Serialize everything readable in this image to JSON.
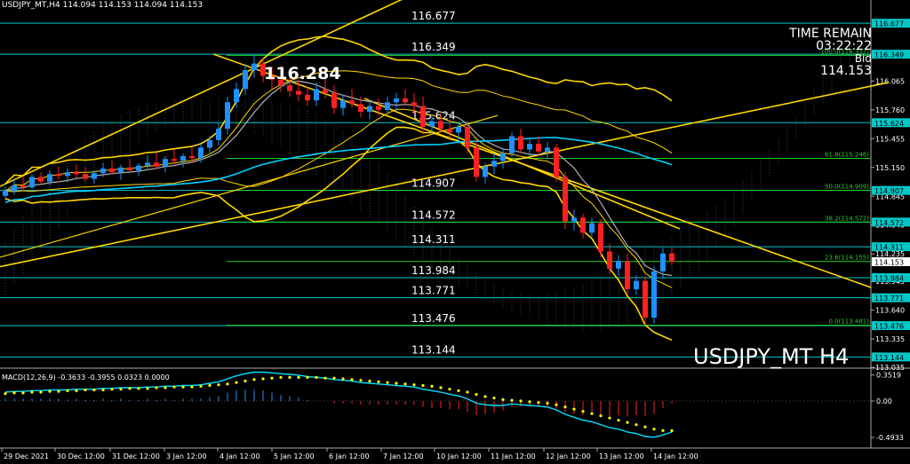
{
  "header": {
    "symbol": "USDJPY_MT,H4",
    "ohlc": "114.094 114.153 114.094 114.153"
  },
  "info": {
    "time_remain_label": "TIME REMAIN",
    "time_remain": "03:22:22",
    "bid_label": "Bid",
    "bid": "114.153"
  },
  "watermark": "USDJPY_MT H4",
  "peak_label": "116.284",
  "colors": {
    "bull": "#1e90ff",
    "bear": "#ff2020",
    "level": "#00c8c8",
    "fib": "#20d020",
    "trend": "#ffd700",
    "ma_fast": "#b0b0b0",
    "ma_slow": "#00d0ff",
    "cloud": "#707070",
    "macd_signal": "#ffff00",
    "macd_line": "#00e0ff",
    "price_tag": "#ffffff"
  },
  "chart_data": {
    "type": "candlestick",
    "ylim": [
      113.035,
      116.81
    ],
    "price_axis_ticks": [
      "116.065",
      "115.760",
      "115.455",
      "115.150",
      "114.845",
      "114.540",
      "114.235",
      "113.945",
      "113.640",
      "113.335",
      "113.035"
    ],
    "time_axis_labels": [
      "29 Dec 2021",
      "30 Dec 12:00",
      "31 Dec 12:00",
      "3 Jan 12:00",
      "4 Jan 12:00",
      "5 Jan 12:00",
      "6 Jan 12:00",
      "7 Jan 12:00",
      "10 Jan 12:00",
      "11 Jan 12:00",
      "12 Jan 12:00",
      "13 Jan 12:00",
      "14 Jan 12:00"
    ],
    "levels": [
      {
        "label": "116.677",
        "value": 116.677
      },
      {
        "label": "116.349",
        "value": 116.349
      },
      {
        "label": "115.624",
        "value": 115.624
      },
      {
        "label": "114.907",
        "value": 114.907
      },
      {
        "label": "114.572",
        "value": 114.572
      },
      {
        "label": "114.311",
        "value": 114.311
      },
      {
        "label": "113.984",
        "value": 113.984
      },
      {
        "label": "113.771",
        "value": 113.771
      },
      {
        "label": "113.476",
        "value": 113.476
      },
      {
        "label": "113.144",
        "value": 113.144
      }
    ],
    "fibonacci": [
      {
        "label": "100.0(116.337)",
        "value": 116.337
      },
      {
        "label": "61.8(115.246)",
        "value": 115.246
      },
      {
        "label": "50.0(114.909)",
        "value": 114.909
      },
      {
        "label": "38.2(114.572)",
        "value": 114.572
      },
      {
        "label": "23.6(114.155)",
        "value": 114.155
      },
      {
        "label": "0.0(113.481)",
        "value": 113.481
      }
    ],
    "current_price": {
      "label": "114.153",
      "value": 114.153
    },
    "candles": [
      [
        114.85,
        114.95,
        114.8,
        114.9
      ],
      [
        114.9,
        115.02,
        114.86,
        114.96
      ],
      [
        114.96,
        115.05,
        114.9,
        114.94
      ],
      [
        114.94,
        115.08,
        114.92,
        115.05
      ],
      [
        115.05,
        115.1,
        114.98,
        115.0
      ],
      [
        115.0,
        115.12,
        114.96,
        115.08
      ],
      [
        115.08,
        115.16,
        115.02,
        115.06
      ],
      [
        115.06,
        115.14,
        115.0,
        115.1
      ],
      [
        115.1,
        115.18,
        115.04,
        115.08
      ],
      [
        115.08,
        115.15,
        115.0,
        115.03
      ],
      [
        115.03,
        115.12,
        114.98,
        115.09
      ],
      [
        115.09,
        115.2,
        115.05,
        115.14
      ],
      [
        115.14,
        115.22,
        115.08,
        115.1
      ],
      [
        115.1,
        115.18,
        115.02,
        115.15
      ],
      [
        115.15,
        115.24,
        115.1,
        115.12
      ],
      [
        115.12,
        115.2,
        115.06,
        115.17
      ],
      [
        115.17,
        115.28,
        115.12,
        115.2
      ],
      [
        115.2,
        115.3,
        115.14,
        115.16
      ],
      [
        115.16,
        115.27,
        115.1,
        115.24
      ],
      [
        115.24,
        115.34,
        115.18,
        115.22
      ],
      [
        115.22,
        115.3,
        115.15,
        115.27
      ],
      [
        115.27,
        115.36,
        115.2,
        115.25
      ],
      [
        115.25,
        115.4,
        115.2,
        115.36
      ],
      [
        115.36,
        115.48,
        115.3,
        115.44
      ],
      [
        115.44,
        115.62,
        115.38,
        115.56
      ],
      [
        115.56,
        115.9,
        115.5,
        115.84
      ],
      [
        115.84,
        116.05,
        115.78,
        115.98
      ],
      [
        115.98,
        116.25,
        115.92,
        116.18
      ],
      [
        116.18,
        116.34,
        116.1,
        116.25
      ],
      [
        116.25,
        116.3,
        116.05,
        116.12
      ],
      [
        116.12,
        116.22,
        115.98,
        116.08
      ],
      [
        116.08,
        116.18,
        115.95,
        116.02
      ],
      [
        116.02,
        116.12,
        115.9,
        115.96
      ],
      [
        115.96,
        116.08,
        115.85,
        115.92
      ],
      [
        115.92,
        116.0,
        115.8,
        115.86
      ],
      [
        115.86,
        116.05,
        115.8,
        115.98
      ],
      [
        115.98,
        116.1,
        115.88,
        115.94
      ],
      [
        115.94,
        116.02,
        115.72,
        115.78
      ],
      [
        115.78,
        115.92,
        115.7,
        115.86
      ],
      [
        115.86,
        115.98,
        115.78,
        115.82
      ],
      [
        115.82,
        115.9,
        115.68,
        115.74
      ],
      [
        115.74,
        115.86,
        115.66,
        115.8
      ],
      [
        115.8,
        115.88,
        115.7,
        115.76
      ],
      [
        115.76,
        115.9,
        115.72,
        115.84
      ],
      [
        115.84,
        115.94,
        115.76,
        115.88
      ],
      [
        115.88,
        115.98,
        115.8,
        115.84
      ],
      [
        115.84,
        115.94,
        115.72,
        115.8
      ],
      [
        115.8,
        115.9,
        115.5,
        115.58
      ],
      [
        115.58,
        115.7,
        115.5,
        115.64
      ],
      [
        115.64,
        115.72,
        115.52,
        115.56
      ],
      [
        115.56,
        115.66,
        115.44,
        115.52
      ],
      [
        115.52,
        115.62,
        115.4,
        115.58
      ],
      [
        115.58,
        115.64,
        115.3,
        115.36
      ],
      [
        115.36,
        115.44,
        115.0,
        115.05
      ],
      [
        115.05,
        115.2,
        114.98,
        115.16
      ],
      [
        115.16,
        115.3,
        115.08,
        115.22
      ],
      [
        115.22,
        115.36,
        115.14,
        115.3
      ],
      [
        115.3,
        115.52,
        115.26,
        115.48
      ],
      [
        115.48,
        115.56,
        115.3,
        115.34
      ],
      [
        115.34,
        115.46,
        115.26,
        115.4
      ],
      [
        115.4,
        115.48,
        115.28,
        115.32
      ],
      [
        115.32,
        115.42,
        115.24,
        115.36
      ],
      [
        115.36,
        115.4,
        115.0,
        115.05
      ],
      [
        115.05,
        115.1,
        114.5,
        114.58
      ],
      [
        114.58,
        114.7,
        114.48,
        114.62
      ],
      [
        114.62,
        114.66,
        114.4,
        114.46
      ],
      [
        114.46,
        114.62,
        114.42,
        114.56
      ],
      [
        114.56,
        114.6,
        114.2,
        114.26
      ],
      [
        114.26,
        114.34,
        114.02,
        114.08
      ],
      [
        114.08,
        114.22,
        114.0,
        114.16
      ],
      [
        114.16,
        114.24,
        113.8,
        113.86
      ],
      [
        113.86,
        114.0,
        113.8,
        113.95
      ],
      [
        113.95,
        114.0,
        113.48,
        113.56
      ],
      [
        113.56,
        114.1,
        113.5,
        114.05
      ],
      [
        114.05,
        114.3,
        113.98,
        114.24
      ],
      [
        114.24,
        114.3,
        114.12,
        114.153
      ]
    ],
    "macd": {
      "label": "MACD(12,26,9) -0.3633 -0.3955 0.0323 0.0000",
      "ylim": [
        -0.6,
        0.42
      ],
      "axis_ticks": [
        "0.3519",
        "0.00",
        "-0.4933"
      ],
      "main": [
        0.12,
        0.13,
        0.13,
        0.14,
        0.14,
        0.15,
        0.15,
        0.15,
        0.16,
        0.16,
        0.16,
        0.17,
        0.17,
        0.18,
        0.18,
        0.18,
        0.19,
        0.19,
        0.2,
        0.2,
        0.21,
        0.21,
        0.22,
        0.24,
        0.26,
        0.3,
        0.34,
        0.37,
        0.39,
        0.39,
        0.38,
        0.37,
        0.36,
        0.35,
        0.33,
        0.32,
        0.31,
        0.29,
        0.28,
        0.27,
        0.25,
        0.24,
        0.23,
        0.22,
        0.21,
        0.2,
        0.19,
        0.16,
        0.14,
        0.12,
        0.09,
        0.07,
        0.03,
        -0.03,
        -0.05,
        -0.06,
        -0.06,
        -0.04,
        -0.05,
        -0.06,
        -0.07,
        -0.08,
        -0.12,
        -0.18,
        -0.22,
        -0.26,
        -0.28,
        -0.32,
        -0.36,
        -0.38,
        -0.42,
        -0.44,
        -0.48,
        -0.49,
        -0.46,
        -0.42
      ],
      "signal": [
        0.1,
        0.11,
        0.11,
        0.12,
        0.12,
        0.13,
        0.13,
        0.14,
        0.14,
        0.15,
        0.15,
        0.15,
        0.16,
        0.16,
        0.17,
        0.17,
        0.17,
        0.18,
        0.18,
        0.19,
        0.19,
        0.19,
        0.2,
        0.21,
        0.22,
        0.23,
        0.25,
        0.27,
        0.29,
        0.3,
        0.31,
        0.32,
        0.32,
        0.32,
        0.32,
        0.32,
        0.31,
        0.31,
        0.3,
        0.29,
        0.28,
        0.27,
        0.26,
        0.25,
        0.24,
        0.23,
        0.22,
        0.21,
        0.2,
        0.18,
        0.16,
        0.14,
        0.12,
        0.09,
        0.06,
        0.04,
        0.02,
        0.01,
        0.0,
        -0.01,
        -0.02,
        -0.03,
        -0.05,
        -0.08,
        -0.11,
        -0.14,
        -0.17,
        -0.2,
        -0.23,
        -0.26,
        -0.29,
        -0.32,
        -0.35,
        -0.38,
        -0.4,
        -0.4
      ]
    }
  }
}
